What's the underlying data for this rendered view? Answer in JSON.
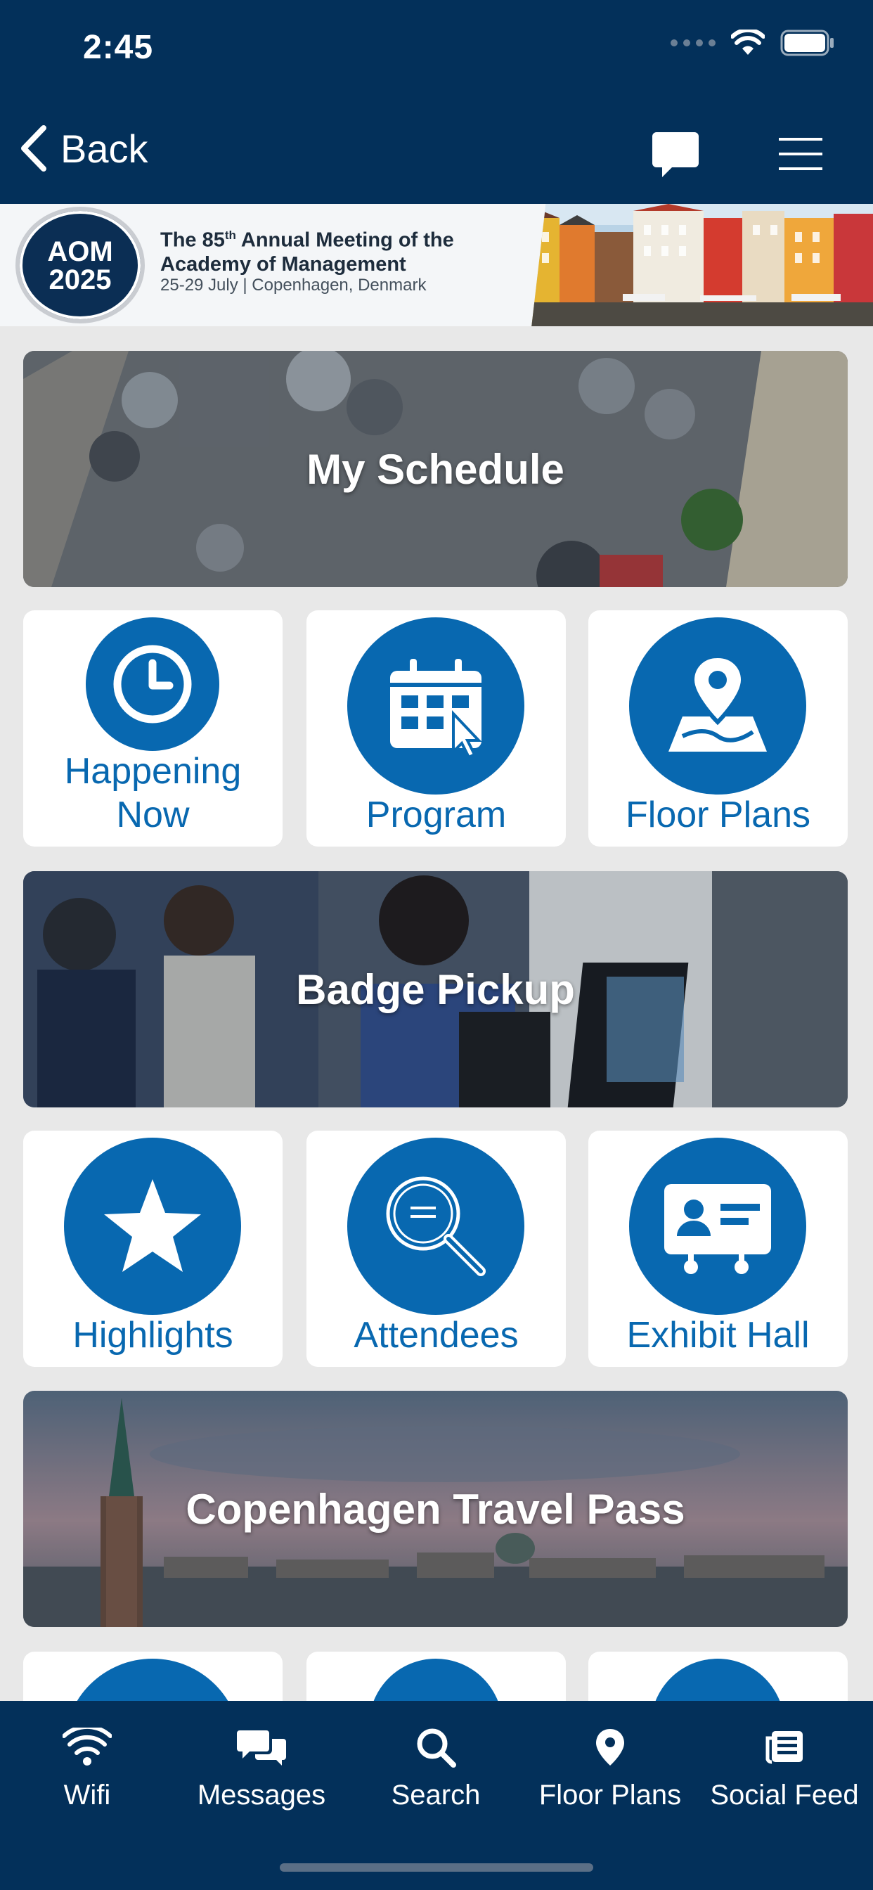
{
  "status_bar": {
    "time": "2:45"
  },
  "nav": {
    "back_label": "Back"
  },
  "banner": {
    "logo_line1": "AOM",
    "logo_line2": "2025",
    "title_prefix": "The 85",
    "title_sup": "th",
    "title_suffix": " Annual Meeting of the",
    "title_line2": "Academy of Management",
    "subtitle": "25-29 July | Copenhagen, Denmark"
  },
  "tiles": {
    "my_schedule": "My Schedule",
    "happening_now_1": "Happening",
    "happening_now_2": "Now",
    "program": "Program",
    "floor_plans": "Floor Plans",
    "badge_pickup": "Badge Pickup",
    "highlights": "Highlights",
    "attendees": "Attendees",
    "exhibit_hall": "Exhibit Hall",
    "travel_pass": "Copenhagen Travel Pass"
  },
  "tabbar": {
    "items": [
      {
        "label": "Wifi",
        "icon": "wifi-icon"
      },
      {
        "label": "Messages",
        "icon": "messages-icon"
      },
      {
        "label": "Search",
        "icon": "search-icon"
      },
      {
        "label": "Floor Plans",
        "icon": "map-pin-icon"
      },
      {
        "label": "Social Feed",
        "icon": "news-feed-icon"
      }
    ]
  },
  "colors": {
    "header": "#03305a",
    "accent": "#0868b0",
    "background": "#e8e8e8"
  }
}
